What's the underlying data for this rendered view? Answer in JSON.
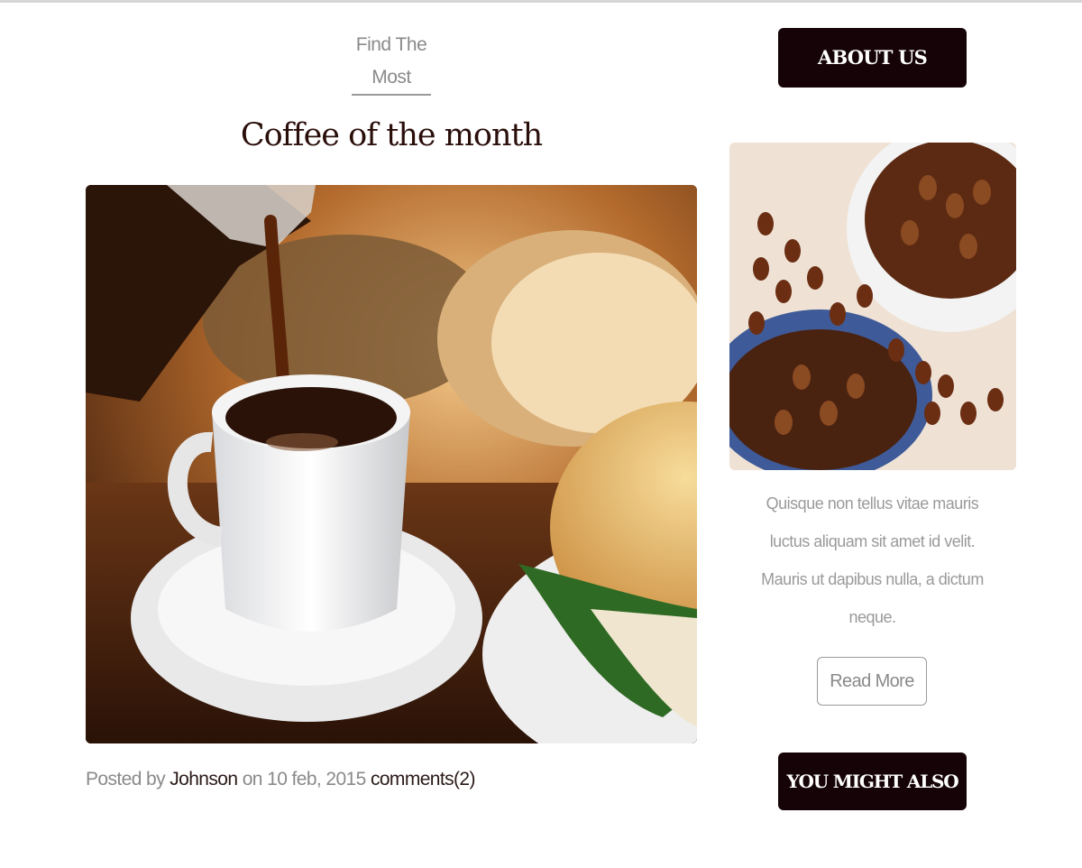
{
  "post": {
    "kicker": "Find The Most",
    "title": "Coffee of the month",
    "meta": {
      "posted_by_label": "Posted by",
      "author": "Johnson",
      "on_label": "on",
      "date": "10 feb, 2015",
      "comments": "comments(2)"
    }
  },
  "sidebar": {
    "about_label": "ABOUT US",
    "excerpt": "Quisque non tellus vitae mauris luctus aliquam sit amet id velit. Mauris ut dapibus nulla, a dictum neque.",
    "read_more_label": "Read More",
    "also_like_label": "YOU MIGHT ALSO LIKE"
  },
  "colors": {
    "button_dark": "#150307",
    "title": "#2a0e0a",
    "muted_text": "#8a8a8a"
  }
}
